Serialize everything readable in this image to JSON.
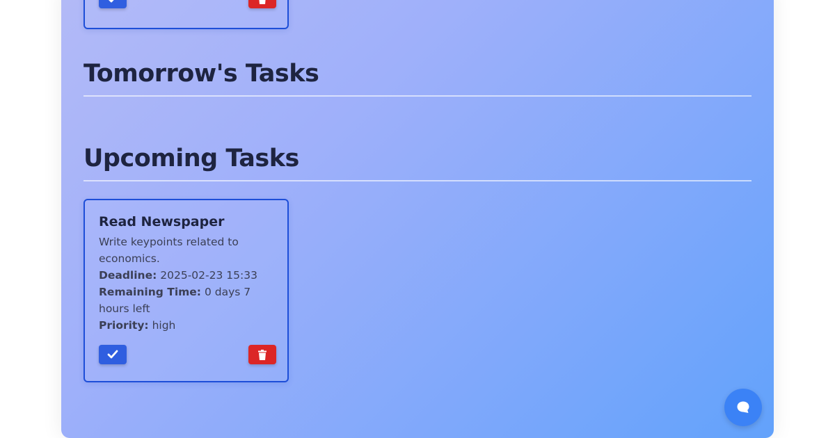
{
  "sections": {
    "tomorrow_title": "Tomorrow's Tasks",
    "upcoming_title": "Upcoming Tasks"
  },
  "task": {
    "title": "Read Newspaper",
    "description": "Write keypoints related to economics.",
    "deadline_label": "Deadline:",
    "deadline_value": "2025-02-23 15:33",
    "remaining_label": "Remaining Time:",
    "remaining_value": "0 days 7 hours left",
    "priority_label": "Priority:",
    "priority_value": "high"
  },
  "icons": {
    "done": "check-icon",
    "delete": "trash-icon",
    "chat": "chat-icon"
  },
  "colors": {
    "done_button": "#2f5ee0",
    "delete_button": "#dc2626",
    "card_border": "#1d4ed8",
    "chat_button": "#3b82f6"
  }
}
